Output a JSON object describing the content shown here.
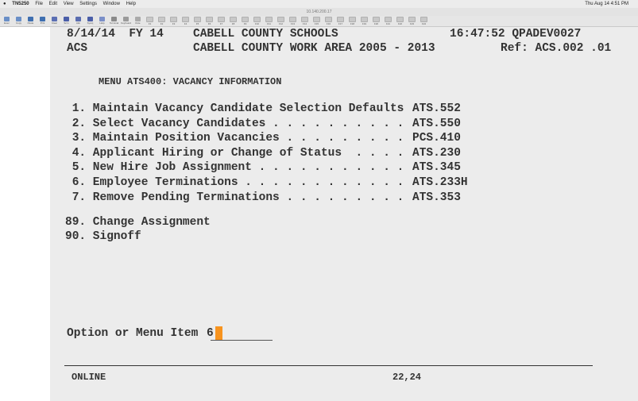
{
  "menubar": {
    "items": [
      "TN5250",
      "File",
      "Edit",
      "View",
      "Settings",
      "Window",
      "Help"
    ],
    "right": "Thu Aug 14 4:51 PM"
  },
  "titlebar": {
    "title": "10.140.200.17"
  },
  "toolbar": {
    "buttons": [
      "Exec",
      "Copy",
      "Paste",
      "Prnt",
      "Clear",
      "Scrn",
      "Attn",
      "Sysrq",
      "Help",
      "Terminal",
      "Keyboard",
      "Rule",
      "F1",
      "F2",
      "F3",
      "F4",
      "F5",
      "F6",
      "F7",
      "F8",
      "F9",
      "F10",
      "F11",
      "F12",
      "F13",
      "F14",
      "F15",
      "F16",
      "F17",
      "F18",
      "F19",
      "F20",
      "F21",
      "F22",
      "F23",
      "F24"
    ]
  },
  "header": {
    "line1_left": "8/14/14  FY 14",
    "line1_center": "CABELL COUNTY SCHOOLS",
    "line1_right": "16:47:52 QPADEV0027",
    "line2_left": "ACS",
    "line2_center": "CABELL COUNTY WORK AREA 2005 - 2013",
    "line2_right": "Ref: ACS.002 .01"
  },
  "menu": {
    "title": "MENU ATS400: VACANCY INFORMATION",
    "items": [
      {
        "label": " 1. Maintain Vacancy Candidate Selection Defaults",
        "code": "ATS.552"
      },
      {
        "label": " 2. Select Vacancy Candidates . . . . . . . . . .",
        "code": "ATS.550"
      },
      {
        "label": " 3. Maintain Position Vacancies . . . . . . . . .",
        "code": "PCS.410"
      },
      {
        "label": " 4. Applicant Hiring or Change of Status  . . . .",
        "code": "ATS.230"
      },
      {
        "label": " 5. New Hire Job Assignment . . . . . . . . . . .",
        "code": "ATS.345"
      },
      {
        "label": " 6. Employee Terminations . . . . . . . . . . . .",
        "code": "ATS.233H"
      },
      {
        "label": " 7. Remove Pending Terminations . . . . . . . . .",
        "code": "ATS.353"
      }
    ],
    "extra_items": [
      "89. Change Assignment",
      "90. Signoff"
    ]
  },
  "option": {
    "label": "Option or Menu Item",
    "value": "6"
  },
  "status": {
    "mode": "ONLINE",
    "cursor_pos": "22,24"
  },
  "colors": {
    "cursor": "#f7931e",
    "screen_bg": "#ececec",
    "text": "#333333"
  }
}
